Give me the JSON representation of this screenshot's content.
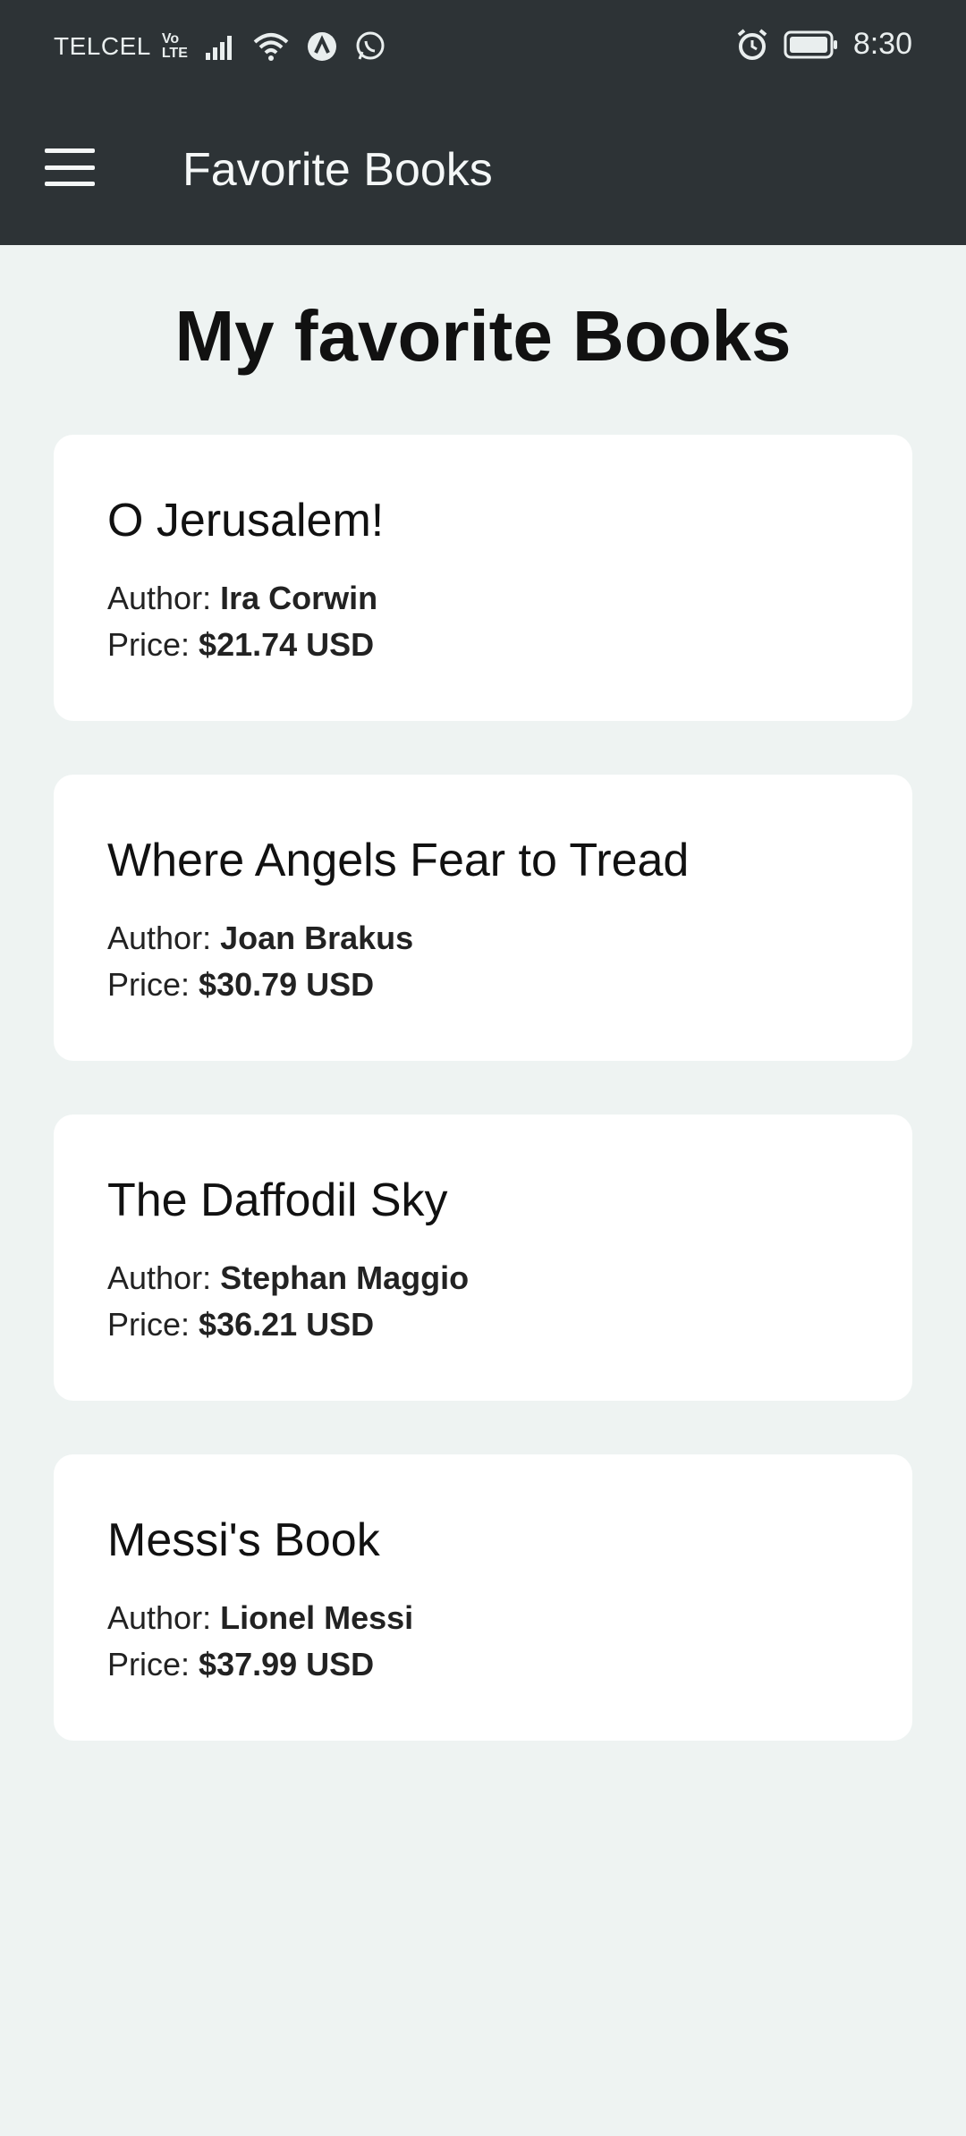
{
  "status_bar": {
    "carrier": "TELCEL",
    "volte_top": "Vo",
    "volte_bottom": "LTE",
    "time": "8:30"
  },
  "app_bar": {
    "title": "Favorite Books"
  },
  "page": {
    "heading": "My favorite Books"
  },
  "labels": {
    "author": "Author:",
    "price": "Price:"
  },
  "books": [
    {
      "title": "O Jerusalem!",
      "author": "Ira Corwin",
      "price": "$21.74 USD"
    },
    {
      "title": "Where Angels Fear to Tread",
      "author": "Joan Brakus",
      "price": "$30.79 USD"
    },
    {
      "title": "The Daffodil Sky",
      "author": "Stephan Maggio",
      "price": "$36.21 USD"
    },
    {
      "title": "Messi's Book",
      "author": "Lionel Messi",
      "price": "$37.99 USD"
    }
  ],
  "icons": [
    "signal-icon",
    "wifi-icon",
    "app-notification-icon",
    "whatsapp-icon",
    "alarm-icon",
    "battery-icon",
    "menu-icon"
  ]
}
